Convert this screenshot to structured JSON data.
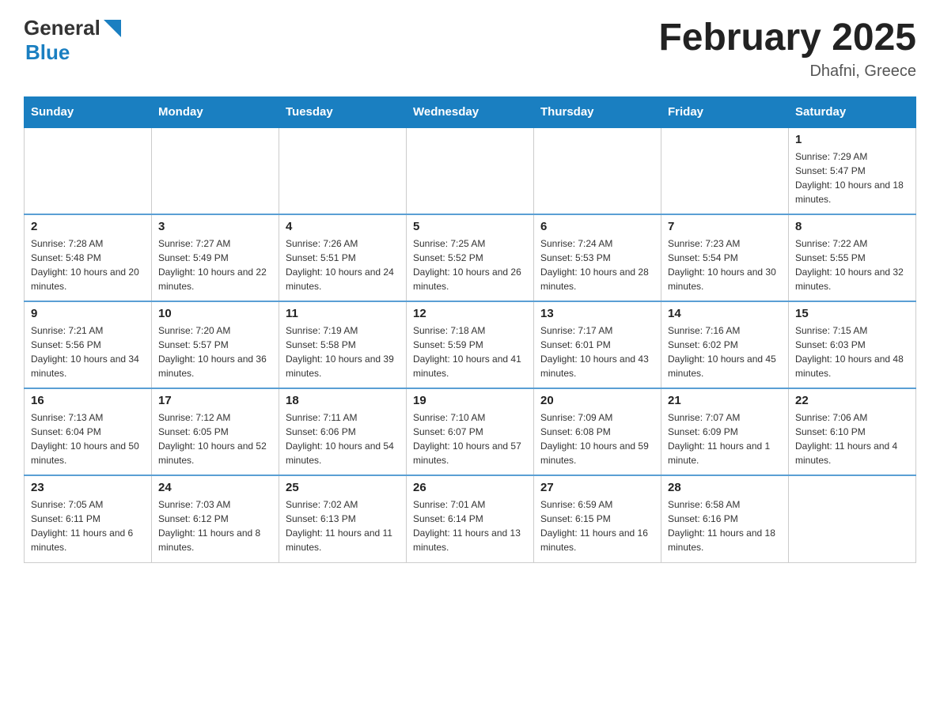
{
  "header": {
    "logo": {
      "general": "General",
      "blue": "Blue",
      "alt": "GeneralBlue logo"
    },
    "title": "February 2025",
    "location": "Dhafni, Greece"
  },
  "weekdays": [
    "Sunday",
    "Monday",
    "Tuesday",
    "Wednesday",
    "Thursday",
    "Friday",
    "Saturday"
  ],
  "weeks": [
    [
      {
        "day": "",
        "info": ""
      },
      {
        "day": "",
        "info": ""
      },
      {
        "day": "",
        "info": ""
      },
      {
        "day": "",
        "info": ""
      },
      {
        "day": "",
        "info": ""
      },
      {
        "day": "",
        "info": ""
      },
      {
        "day": "1",
        "info": "Sunrise: 7:29 AM\nSunset: 5:47 PM\nDaylight: 10 hours and 18 minutes."
      }
    ],
    [
      {
        "day": "2",
        "info": "Sunrise: 7:28 AM\nSunset: 5:48 PM\nDaylight: 10 hours and 20 minutes."
      },
      {
        "day": "3",
        "info": "Sunrise: 7:27 AM\nSunset: 5:49 PM\nDaylight: 10 hours and 22 minutes."
      },
      {
        "day": "4",
        "info": "Sunrise: 7:26 AM\nSunset: 5:51 PM\nDaylight: 10 hours and 24 minutes."
      },
      {
        "day": "5",
        "info": "Sunrise: 7:25 AM\nSunset: 5:52 PM\nDaylight: 10 hours and 26 minutes."
      },
      {
        "day": "6",
        "info": "Sunrise: 7:24 AM\nSunset: 5:53 PM\nDaylight: 10 hours and 28 minutes."
      },
      {
        "day": "7",
        "info": "Sunrise: 7:23 AM\nSunset: 5:54 PM\nDaylight: 10 hours and 30 minutes."
      },
      {
        "day": "8",
        "info": "Sunrise: 7:22 AM\nSunset: 5:55 PM\nDaylight: 10 hours and 32 minutes."
      }
    ],
    [
      {
        "day": "9",
        "info": "Sunrise: 7:21 AM\nSunset: 5:56 PM\nDaylight: 10 hours and 34 minutes."
      },
      {
        "day": "10",
        "info": "Sunrise: 7:20 AM\nSunset: 5:57 PM\nDaylight: 10 hours and 36 minutes."
      },
      {
        "day": "11",
        "info": "Sunrise: 7:19 AM\nSunset: 5:58 PM\nDaylight: 10 hours and 39 minutes."
      },
      {
        "day": "12",
        "info": "Sunrise: 7:18 AM\nSunset: 5:59 PM\nDaylight: 10 hours and 41 minutes."
      },
      {
        "day": "13",
        "info": "Sunrise: 7:17 AM\nSunset: 6:01 PM\nDaylight: 10 hours and 43 minutes."
      },
      {
        "day": "14",
        "info": "Sunrise: 7:16 AM\nSunset: 6:02 PM\nDaylight: 10 hours and 45 minutes."
      },
      {
        "day": "15",
        "info": "Sunrise: 7:15 AM\nSunset: 6:03 PM\nDaylight: 10 hours and 48 minutes."
      }
    ],
    [
      {
        "day": "16",
        "info": "Sunrise: 7:13 AM\nSunset: 6:04 PM\nDaylight: 10 hours and 50 minutes."
      },
      {
        "day": "17",
        "info": "Sunrise: 7:12 AM\nSunset: 6:05 PM\nDaylight: 10 hours and 52 minutes."
      },
      {
        "day": "18",
        "info": "Sunrise: 7:11 AM\nSunset: 6:06 PM\nDaylight: 10 hours and 54 minutes."
      },
      {
        "day": "19",
        "info": "Sunrise: 7:10 AM\nSunset: 6:07 PM\nDaylight: 10 hours and 57 minutes."
      },
      {
        "day": "20",
        "info": "Sunrise: 7:09 AM\nSunset: 6:08 PM\nDaylight: 10 hours and 59 minutes."
      },
      {
        "day": "21",
        "info": "Sunrise: 7:07 AM\nSunset: 6:09 PM\nDaylight: 11 hours and 1 minute."
      },
      {
        "day": "22",
        "info": "Sunrise: 7:06 AM\nSunset: 6:10 PM\nDaylight: 11 hours and 4 minutes."
      }
    ],
    [
      {
        "day": "23",
        "info": "Sunrise: 7:05 AM\nSunset: 6:11 PM\nDaylight: 11 hours and 6 minutes."
      },
      {
        "day": "24",
        "info": "Sunrise: 7:03 AM\nSunset: 6:12 PM\nDaylight: 11 hours and 8 minutes."
      },
      {
        "day": "25",
        "info": "Sunrise: 7:02 AM\nSunset: 6:13 PM\nDaylight: 11 hours and 11 minutes."
      },
      {
        "day": "26",
        "info": "Sunrise: 7:01 AM\nSunset: 6:14 PM\nDaylight: 11 hours and 13 minutes."
      },
      {
        "day": "27",
        "info": "Sunrise: 6:59 AM\nSunset: 6:15 PM\nDaylight: 11 hours and 16 minutes."
      },
      {
        "day": "28",
        "info": "Sunrise: 6:58 AM\nSunset: 6:16 PM\nDaylight: 11 hours and 18 minutes."
      },
      {
        "day": "",
        "info": ""
      }
    ]
  ]
}
